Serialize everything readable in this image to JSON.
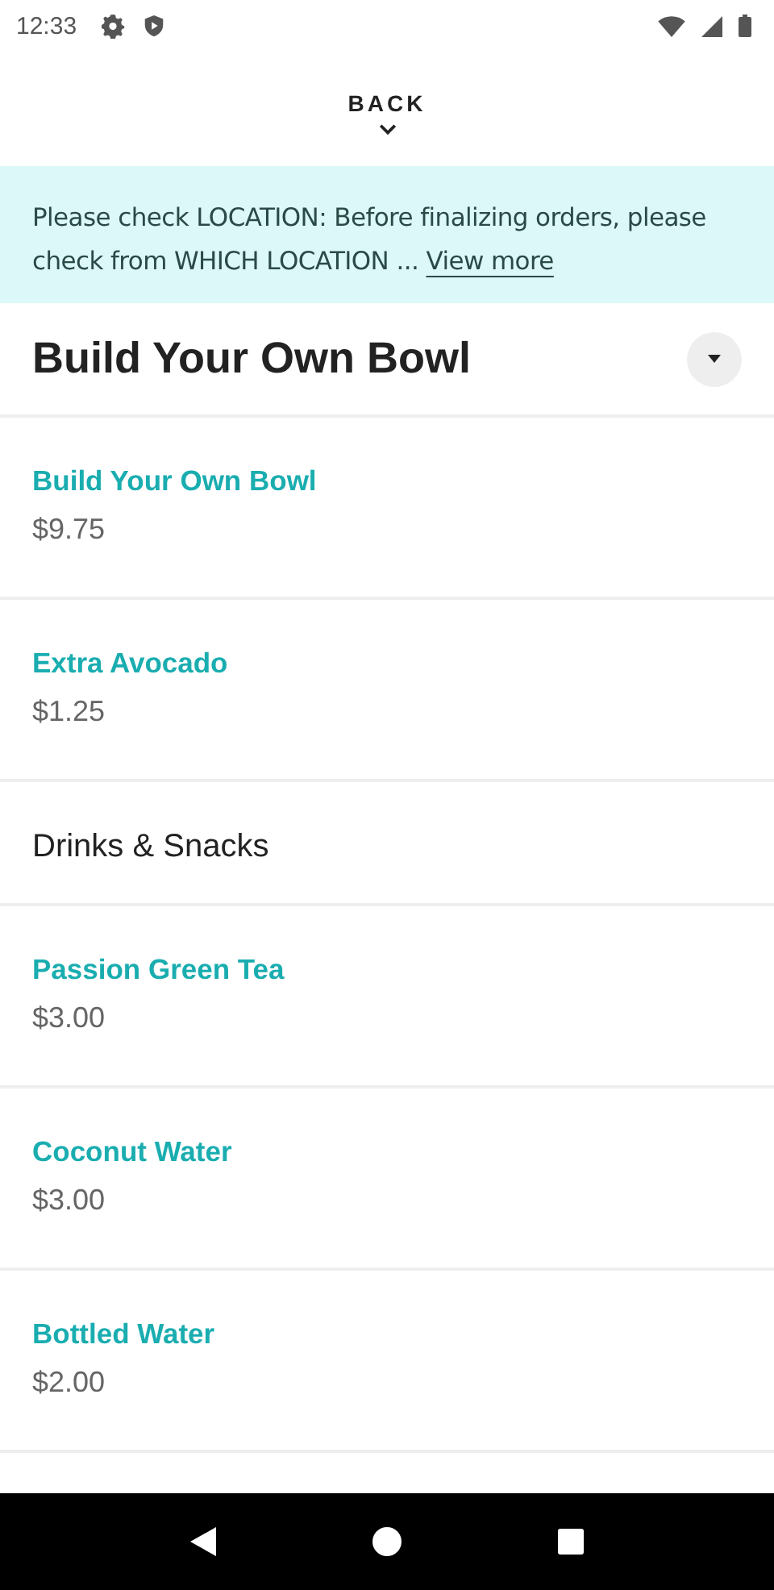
{
  "status_bar": {
    "time": "12:33"
  },
  "header": {
    "back_label": "BACK"
  },
  "notice": {
    "text": "Please check LOCATION: Before finalizing orders, please check from WHICH LOCATION ...",
    "link": "View more"
  },
  "sections": [
    {
      "kind": "main",
      "title": "Build Your Own Bowl",
      "items": [
        {
          "name": "Build Your Own Bowl",
          "price": "$9.75"
        },
        {
          "name": "Extra Avocado",
          "price": "$1.25"
        }
      ]
    },
    {
      "kind": "sub",
      "title": "Drinks & Snacks",
      "items": [
        {
          "name": "Passion Green Tea",
          "price": "$3.00"
        },
        {
          "name": "Coconut Water",
          "price": "$3.00"
        },
        {
          "name": "Bottled Water",
          "price": "$2.00"
        }
      ]
    }
  ]
}
